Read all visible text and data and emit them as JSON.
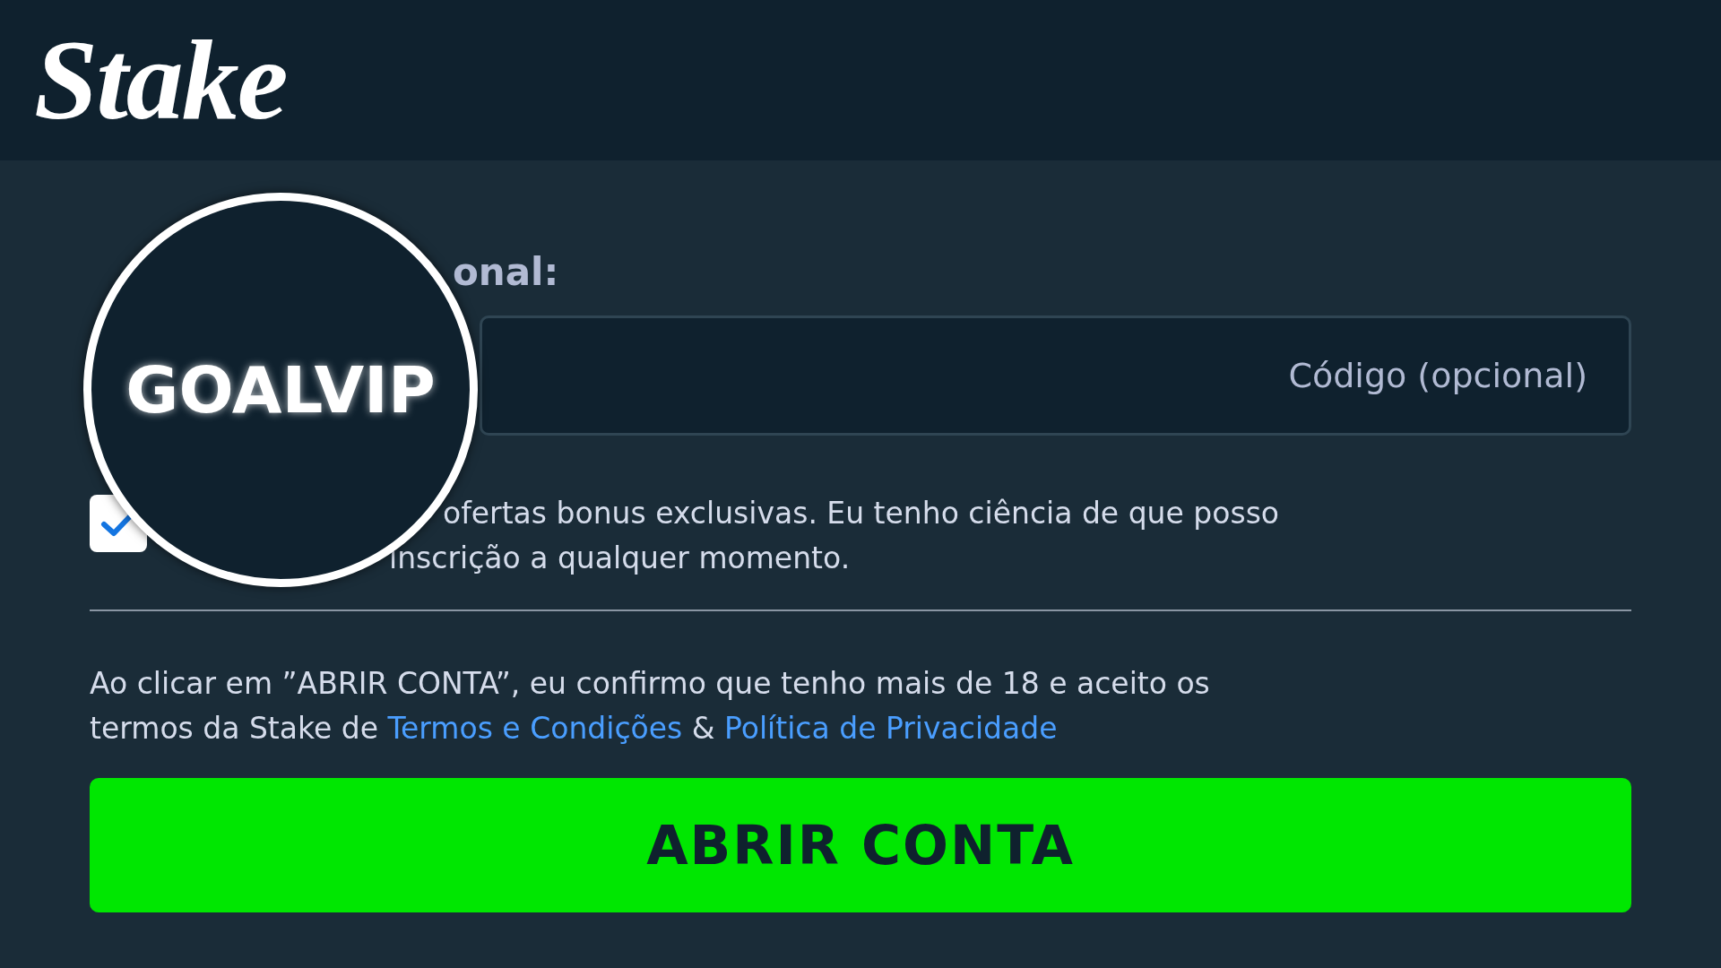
{
  "header": {
    "logo": "Stake"
  },
  "promo": {
    "label": "onal:",
    "placeholder": "Código (opcional)"
  },
  "magnifier": {
    "text": "GOALVIP"
  },
  "offers": {
    "checked": true,
    "lines": [
      "ofertas bonus exclusivas. Eu tenho ciência de que posso",
      "inscrição a qualquer momento."
    ]
  },
  "terms": {
    "text": "Ao clicar em ”ABRIR CONTA”, eu confirmo que tenho mais de 18 e aceito os termos da Stake de",
    "link1": "Termos e Condições",
    "joiner": "&",
    "link2": "Política de Privacidade"
  },
  "submit": {
    "label": "ABRIR CONTA"
  }
}
